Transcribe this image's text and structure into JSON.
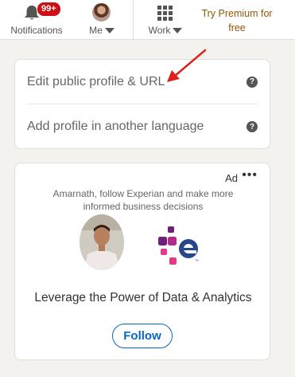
{
  "nav": {
    "notifications_label": "Notifications",
    "notifications_badge": "99+",
    "me_label": "Me",
    "work_label": "Work",
    "premium_line1": "Try Premium for",
    "premium_line2": "free"
  },
  "profile_card": {
    "edit_profile_label": "Edit public profile & URL",
    "add_language_label": "Add profile in another language",
    "help_glyph": "?"
  },
  "ad_card": {
    "ad_label": "Ad",
    "more_glyph": "•••",
    "message": "Amarnath, follow Experian and make more informed business decisions",
    "headline": "Leverage the Power of Data & Analytics",
    "follow_label": "Follow"
  },
  "colors": {
    "accent": "#0a66c2",
    "badge": "#cc1016",
    "premium": "#915907",
    "arrow": "#e0201b"
  }
}
